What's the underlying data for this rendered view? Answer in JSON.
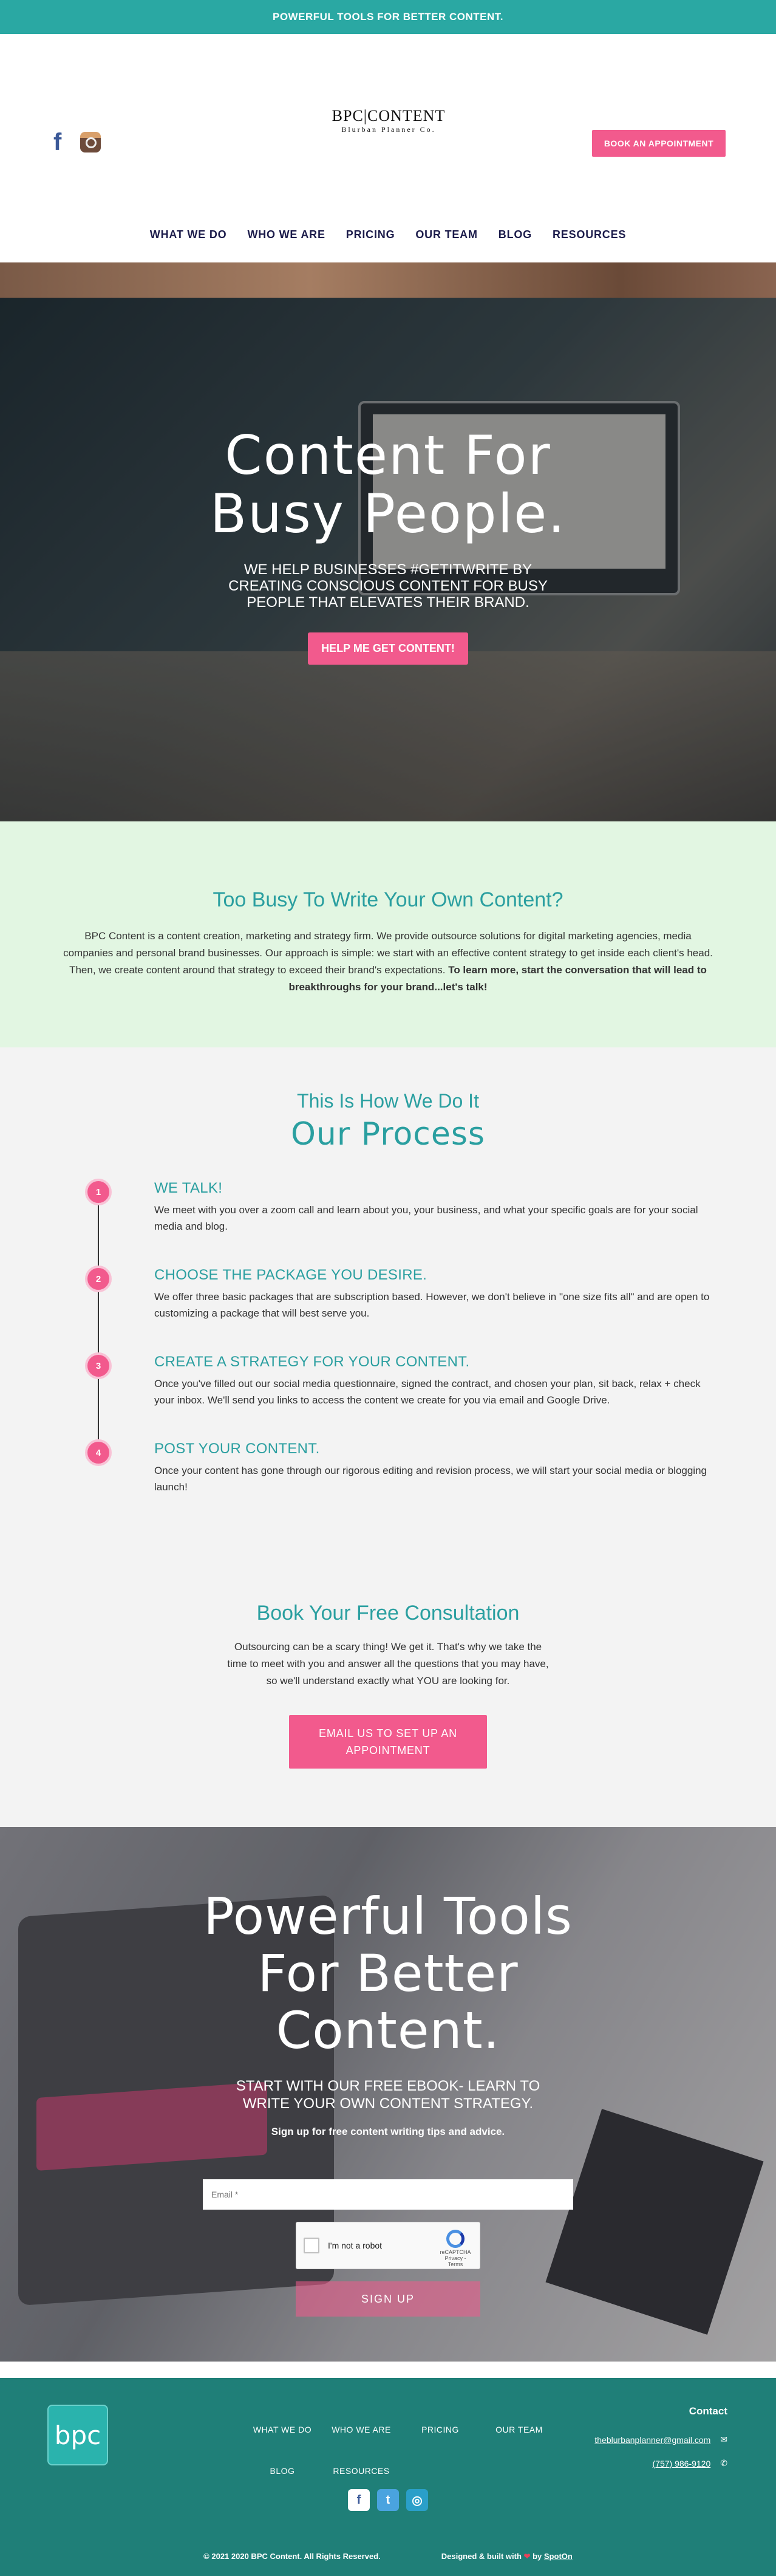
{
  "topbar": {
    "text": "POWERFUL TOOLS FOR BETTER CONTENT."
  },
  "header": {
    "logo_main": "BPC|CONTENT",
    "logo_sub": "Blurban Planner Co.",
    "book_button": "BOOK AN APPOINTMENT",
    "social": [
      "facebook-icon",
      "instagram-icon"
    ],
    "nav": [
      "WHAT WE DO",
      "WHO WE ARE",
      "PRICING",
      "OUR TEAM",
      "BLOG",
      "RESOURCES"
    ]
  },
  "hero": {
    "title_line1": "Content For",
    "title_line2": "Busy People.",
    "subtitle": "WE HELP BUSINESSES #GETITWRITE BY CREATING CONSCIOUS CONTENT FOR BUSY PEOPLE THAT ELEVATES THEIR BRAND.",
    "button": "HELP ME GET CONTENT!"
  },
  "busy": {
    "title": "Too Busy To Write Your Own Content?",
    "body": "BPC Content is a content creation, marketing and strategy firm. We provide outsource solutions for digital marketing agencies, media companies and personal brand businesses. Our approach is simple: we start with an effective content strategy to get inside each client's head. Then, we create content around that strategy to exceed their brand's expectations. ",
    "body_bold": "To learn more, start the conversation that will lead to breakthroughs for your brand...let's talk!"
  },
  "process": {
    "pretitle": "This Is How We Do It",
    "title": "Our Process",
    "steps": [
      {
        "num": "1",
        "title": "WE TALK!",
        "text": "We meet with you over a zoom call and learn about you, your business, and what your specific goals are for your social media and blog."
      },
      {
        "num": "2",
        "title": "CHOOSE THE PACKAGE YOU DESIRE.",
        "text": "We offer three basic packages that are subscription based. However, we don't believe in \"one size fits all\" and are open to customizing a package that will best serve you."
      },
      {
        "num": "3",
        "title": "CREATE A STRATEGY FOR YOUR CONTENT.",
        "text": "Once you've filled out our social media questionnaire, signed the contract, and chosen your plan, sit back, relax + check your inbox. We'll send you links to access the content we create for you via email and Google Drive."
      },
      {
        "num": "4",
        "title": "POST YOUR CONTENT.",
        "text": "Once your content has gone through our rigorous editing and revision process, we will start your social media or blogging launch!"
      }
    ]
  },
  "consult": {
    "title": "Book Your Free Consultation",
    "text": "Outsourcing can be a scary thing! We get it. That's why we take the time to meet with you and answer all the questions that you may have, so we'll understand exactly what YOU are looking for.",
    "button_line1": "EMAIL US TO SET UP AN",
    "button_line2": "APPOINTMENT"
  },
  "ebook": {
    "title_line1": "Powerful Tools",
    "title_line2": "For Better",
    "title_line3": "Content.",
    "subtitle": "START WITH OUR FREE EBOOK- LEARN TO WRITE YOUR OWN CONTENT STRATEGY.",
    "small": "Sign up for free content writing tips and advice.",
    "email_placeholder": "Email *",
    "captcha_label": "I'm not a robot",
    "captcha_brand": "reCAPTCHA",
    "captcha_terms": "Privacy - Terms",
    "button": "SIGN UP"
  },
  "footer": {
    "logo": "bpc",
    "nav": [
      "WHAT WE DO",
      "WHO WE ARE",
      "PRICING",
      "OUR TEAM",
      "BLOG",
      "RESOURCES"
    ],
    "contact_title": "Contact",
    "email": "theblurbanplanner@gmail.com",
    "phone": "(757) 986-9120",
    "copyright": "© 2021 2020 BPC Content. All Rights Reserved.",
    "built_prefix": "Designed & built with",
    "built_by": "by",
    "built_link": "SpotOn"
  },
  "colors": {
    "teal": "#2aa8a3",
    "pink": "#f25a8d",
    "footer": "#1f7f78",
    "mint": "#e2f6e2"
  }
}
